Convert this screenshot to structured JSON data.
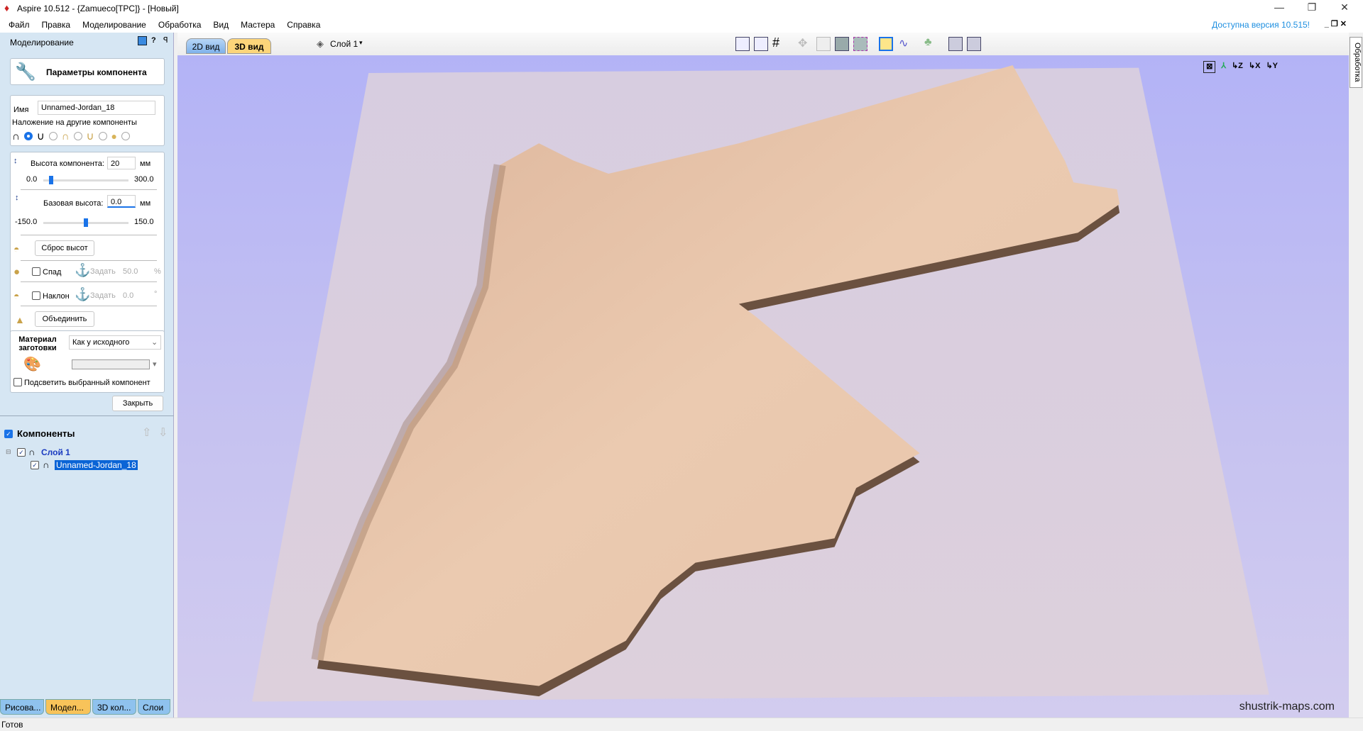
{
  "window": {
    "title": "Aspire 10.512 - {Zamueco[TPC]} - [Новый]",
    "minimize": "—",
    "maximize": "❐",
    "close": "✕"
  },
  "menu": [
    "Файл",
    "Правка",
    "Моделирование",
    "Обработка",
    "Вид",
    "Мастера",
    "Справка"
  ],
  "update_notice": "Доступна версия 10.515!",
  "panel": {
    "title": "Моделирование",
    "header": "Параметры компонента",
    "name_label": "Имя",
    "name_value": "Unnamed-Jordan_18",
    "overlay_label": "Наложение на другие компоненты",
    "overlay_selected": 0,
    "height_label": "Высота компонента:",
    "height_value": "20",
    "height_unit": "мм",
    "height_min": "0.0",
    "height_max": "300.0",
    "height_fraction": 0.067,
    "base_label": "Базовая высота:",
    "base_value": "0.0",
    "base_unit": "мм",
    "base_min": "-150.0",
    "base_max": "150.0",
    "base_fraction": 0.5,
    "reset_button": "Сброс высот",
    "fade_label": "Спад",
    "fade_set": "Задать",
    "fade_value": "50.0",
    "fade_unit": "%",
    "tilt_label": "Наклон",
    "tilt_set": "Задать",
    "tilt_value": "0.0",
    "tilt_unit": "°",
    "merge_button": "Объединить",
    "material_label": "Материал заготовки",
    "material_value": "Как у исходного",
    "highlight_label": "Подсветить выбранный компонент",
    "close_button": "Закрыть"
  },
  "components": {
    "title": "Компоненты",
    "layer": "Слой 1",
    "item": "Unnamed-Jordan_18"
  },
  "bottom_tabs": [
    "Рисова...",
    "Модел...",
    "3D кол...",
    "Слои"
  ],
  "view_tabs": [
    "2D вид",
    "3D вид"
  ],
  "layer_dropdown": "Слой 1",
  "right_tab": "Обработка",
  "watermark": "shustrik-maps.com",
  "status": "Готов",
  "colors": {
    "viewport": "#b3b3f6",
    "relief": "#e8c4a8",
    "relief_side": "#6b5140",
    "accent": "#1a73e8",
    "active_tab": "#fcd57a"
  }
}
